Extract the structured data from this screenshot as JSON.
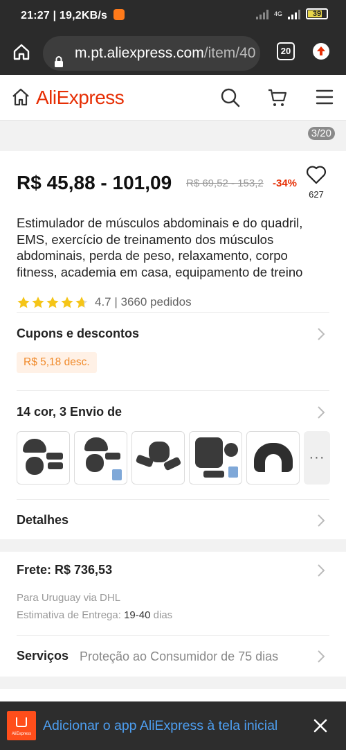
{
  "status_bar": {
    "time": "21:27",
    "speed": "19,2KB/s",
    "network": "4G",
    "battery": "39"
  },
  "browser": {
    "url_host": "m.pt.aliexpress.com",
    "url_path": "/item/40",
    "tab_count": "20"
  },
  "header": {
    "brand": "AliExpress"
  },
  "gallery": {
    "counter": "3/20"
  },
  "product": {
    "price": "R$ 45,88 - 101,09",
    "old_price": "R$ 69,52 - 153,2",
    "discount": "-34%",
    "wishlist_count": "627",
    "title": "Estimulador de músculos abdominais e do quadril, EMS, exercício de treinamento dos músculos abdominais, perda de peso, relaxamento, corpo fitness, academia em casa, equipamento de treino",
    "rating_text": "4.7 | 3660 pedidos",
    "stars": 4.7
  },
  "coupons": {
    "title": "Cupons e descontos",
    "badge": "R$ 5,18 desc."
  },
  "variants": {
    "title": "14 cor, 3 Envio de",
    "more": "···"
  },
  "details": {
    "title": "Detalhes"
  },
  "shipping": {
    "title": "Frete: R$ 736,53",
    "destination": "Para Uruguay via DHL",
    "estimate_label": "Estimativa de Entrega:",
    "estimate_value": "19-40",
    "estimate_unit": "dias"
  },
  "services": {
    "label": "Serviços",
    "text": "Proteção ao Consumidor de 75 dias"
  },
  "banner": {
    "message": "Adicionar o app AliExpress à tela inicial",
    "app_label": "AliExpress"
  },
  "colors": {
    "brand": "#e62e04",
    "discount": "#e62e04",
    "coupon_text": "#f08a2a",
    "banner_link": "#4d9ef0",
    "star": "#f5c518"
  }
}
